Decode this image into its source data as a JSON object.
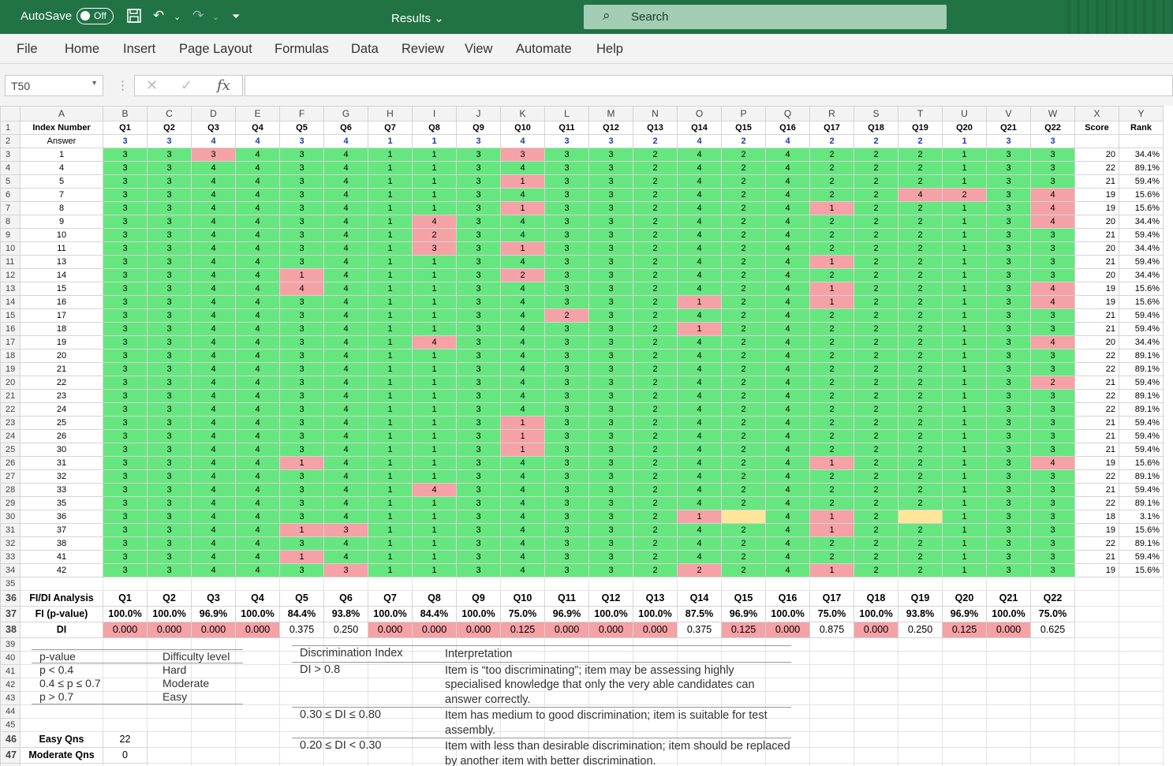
{
  "titlebar": {
    "autosave_label": "AutoSave",
    "autosave_state": "Off",
    "doc_title": "Results ⌄",
    "search_placeholder": "Search"
  },
  "menu": [
    "File",
    "Home",
    "Insert",
    "Page Layout",
    "Formulas",
    "Data",
    "Review",
    "View",
    "Automate",
    "Help"
  ],
  "formula_bar": {
    "name_box": "T50",
    "formula": ""
  },
  "columns": [
    "A",
    "B",
    "C",
    "D",
    "E",
    "F",
    "G",
    "H",
    "I",
    "J",
    "K",
    "L",
    "M",
    "N",
    "O",
    "P",
    "Q",
    "R",
    "S",
    "T",
    "U",
    "V",
    "W",
    "X",
    "Y"
  ],
  "header_row": [
    "Index Number",
    "Q1",
    "Q2",
    "Q3",
    "Q4",
    "Q5",
    "Q6",
    "Q7",
    "Q8",
    "Q9",
    "Q10",
    "Q11",
    "Q12",
    "Q13",
    "Q14",
    "Q15",
    "Q16",
    "Q17",
    "Q18",
    "Q19",
    "Q20",
    "Q21",
    "Q22",
    "Score",
    "Rank"
  ],
  "answer_row": {
    "label": "Answer",
    "values": [
      "3",
      "3",
      "4",
      "4",
      "3",
      "4",
      "1",
      "1",
      "3",
      "4",
      "3",
      "3",
      "2",
      "4",
      "2",
      "4",
      "2",
      "2",
      "2",
      "1",
      "3",
      "3"
    ]
  },
  "students": [
    {
      "id": "1",
      "ans": [
        "3",
        "3",
        "3",
        "4",
        "3",
        "4",
        "1",
        "1",
        "3",
        "3",
        "3",
        "3",
        "2",
        "4",
        "2",
        "4",
        "2",
        "2",
        "2",
        "1",
        "3",
        "3"
      ],
      "score": "20",
      "rank": "34.4%"
    },
    {
      "id": "4",
      "ans": [
        "3",
        "3",
        "4",
        "4",
        "3",
        "4",
        "1",
        "1",
        "3",
        "4",
        "3",
        "3",
        "2",
        "4",
        "2",
        "4",
        "2",
        "2",
        "2",
        "1",
        "3",
        "3"
      ],
      "score": "22",
      "rank": "89.1%"
    },
    {
      "id": "5",
      "ans": [
        "3",
        "3",
        "4",
        "4",
        "3",
        "4",
        "1",
        "1",
        "3",
        "1",
        "3",
        "3",
        "2",
        "4",
        "2",
        "4",
        "2",
        "2",
        "2",
        "1",
        "3",
        "3"
      ],
      "score": "21",
      "rank": "59.4%"
    },
    {
      "id": "7",
      "ans": [
        "3",
        "3",
        "4",
        "4",
        "3",
        "4",
        "1",
        "1",
        "3",
        "4",
        "3",
        "3",
        "2",
        "4",
        "2",
        "4",
        "2",
        "2",
        "4",
        "2",
        "3",
        "4"
      ],
      "score": "19",
      "rank": "15.6%"
    },
    {
      "id": "8",
      "ans": [
        "3",
        "3",
        "4",
        "4",
        "3",
        "4",
        "1",
        "1",
        "3",
        "1",
        "3",
        "3",
        "2",
        "4",
        "2",
        "4",
        "1",
        "2",
        "2",
        "1",
        "3",
        "4"
      ],
      "score": "19",
      "rank": "15.6%"
    },
    {
      "id": "9",
      "ans": [
        "3",
        "3",
        "4",
        "4",
        "3",
        "4",
        "1",
        "4",
        "3",
        "4",
        "3",
        "3",
        "2",
        "4",
        "2",
        "4",
        "2",
        "2",
        "2",
        "1",
        "3",
        "4"
      ],
      "score": "20",
      "rank": "34.4%"
    },
    {
      "id": "10",
      "ans": [
        "3",
        "3",
        "4",
        "4",
        "3",
        "4",
        "1",
        "2",
        "3",
        "4",
        "3",
        "3",
        "2",
        "4",
        "2",
        "4",
        "2",
        "2",
        "2",
        "1",
        "3",
        "3"
      ],
      "score": "21",
      "rank": "59.4%"
    },
    {
      "id": "11",
      "ans": [
        "3",
        "3",
        "4",
        "4",
        "3",
        "4",
        "1",
        "3",
        "3",
        "1",
        "3",
        "3",
        "2",
        "4",
        "2",
        "4",
        "2",
        "2",
        "2",
        "1",
        "3",
        "3"
      ],
      "score": "20",
      "rank": "34.4%"
    },
    {
      "id": "13",
      "ans": [
        "3",
        "3",
        "4",
        "4",
        "3",
        "4",
        "1",
        "1",
        "3",
        "4",
        "3",
        "3",
        "2",
        "4",
        "2",
        "4",
        "1",
        "2",
        "2",
        "1",
        "3",
        "3"
      ],
      "score": "21",
      "rank": "59.4%"
    },
    {
      "id": "14",
      "ans": [
        "3",
        "3",
        "4",
        "4",
        "1",
        "4",
        "1",
        "1",
        "3",
        "2",
        "3",
        "3",
        "2",
        "4",
        "2",
        "4",
        "2",
        "2",
        "2",
        "1",
        "3",
        "3"
      ],
      "score": "20",
      "rank": "34.4%"
    },
    {
      "id": "15",
      "ans": [
        "3",
        "3",
        "4",
        "4",
        "4",
        "4",
        "1",
        "1",
        "3",
        "4",
        "3",
        "3",
        "2",
        "4",
        "2",
        "4",
        "1",
        "2",
        "2",
        "1",
        "3",
        "4"
      ],
      "score": "19",
      "rank": "15.6%"
    },
    {
      "id": "16",
      "ans": [
        "3",
        "3",
        "4",
        "4",
        "3",
        "4",
        "1",
        "1",
        "3",
        "4",
        "3",
        "3",
        "2",
        "1",
        "2",
        "4",
        "1",
        "2",
        "2",
        "1",
        "3",
        "4"
      ],
      "score": "19",
      "rank": "15.6%"
    },
    {
      "id": "17",
      "ans": [
        "3",
        "3",
        "4",
        "4",
        "3",
        "4",
        "1",
        "1",
        "3",
        "4",
        "2",
        "3",
        "2",
        "4",
        "2",
        "4",
        "2",
        "2",
        "2",
        "1",
        "3",
        "3"
      ],
      "score": "21",
      "rank": "59.4%"
    },
    {
      "id": "18",
      "ans": [
        "3",
        "3",
        "4",
        "4",
        "3",
        "4",
        "1",
        "1",
        "3",
        "4",
        "3",
        "3",
        "2",
        "1",
        "2",
        "4",
        "2",
        "2",
        "2",
        "1",
        "3",
        "3"
      ],
      "score": "21",
      "rank": "59.4%"
    },
    {
      "id": "19",
      "ans": [
        "3",
        "3",
        "4",
        "4",
        "3",
        "4",
        "1",
        "4",
        "3",
        "4",
        "3",
        "3",
        "2",
        "4",
        "2",
        "4",
        "2",
        "2",
        "2",
        "1",
        "3",
        "4"
      ],
      "score": "20",
      "rank": "34.4%"
    },
    {
      "id": "20",
      "ans": [
        "3",
        "3",
        "4",
        "4",
        "3",
        "4",
        "1",
        "1",
        "3",
        "4",
        "3",
        "3",
        "2",
        "4",
        "2",
        "4",
        "2",
        "2",
        "2",
        "1",
        "3",
        "3"
      ],
      "score": "22",
      "rank": "89.1%"
    },
    {
      "id": "21",
      "ans": [
        "3",
        "3",
        "4",
        "4",
        "3",
        "4",
        "1",
        "1",
        "3",
        "4",
        "3",
        "3",
        "2",
        "4",
        "2",
        "4",
        "2",
        "2",
        "2",
        "1",
        "3",
        "3"
      ],
      "score": "22",
      "rank": "89.1%"
    },
    {
      "id": "22",
      "ans": [
        "3",
        "3",
        "4",
        "4",
        "3",
        "4",
        "1",
        "1",
        "3",
        "4",
        "3",
        "3",
        "2",
        "4",
        "2",
        "4",
        "2",
        "2",
        "2",
        "1",
        "3",
        "2"
      ],
      "score": "21",
      "rank": "59.4%"
    },
    {
      "id": "23",
      "ans": [
        "3",
        "3",
        "4",
        "4",
        "3",
        "4",
        "1",
        "1",
        "3",
        "4",
        "3",
        "3",
        "2",
        "4",
        "2",
        "4",
        "2",
        "2",
        "2",
        "1",
        "3",
        "3"
      ],
      "score": "22",
      "rank": "89.1%"
    },
    {
      "id": "24",
      "ans": [
        "3",
        "3",
        "4",
        "4",
        "3",
        "4",
        "1",
        "1",
        "3",
        "4",
        "3",
        "3",
        "2",
        "4",
        "2",
        "4",
        "2",
        "2",
        "2",
        "1",
        "3",
        "3"
      ],
      "score": "22",
      "rank": "89.1%"
    },
    {
      "id": "25",
      "ans": [
        "3",
        "3",
        "4",
        "4",
        "3",
        "4",
        "1",
        "1",
        "3",
        "1",
        "3",
        "3",
        "2",
        "4",
        "2",
        "4",
        "2",
        "2",
        "2",
        "1",
        "3",
        "3"
      ],
      "score": "21",
      "rank": "59.4%"
    },
    {
      "id": "26",
      "ans": [
        "3",
        "3",
        "4",
        "4",
        "3",
        "4",
        "1",
        "1",
        "3",
        "1",
        "3",
        "3",
        "2",
        "4",
        "2",
        "4",
        "2",
        "2",
        "2",
        "1",
        "3",
        "3"
      ],
      "score": "21",
      "rank": "59.4%"
    },
    {
      "id": "30",
      "ans": [
        "3",
        "3",
        "4",
        "4",
        "3",
        "4",
        "1",
        "1",
        "3",
        "1",
        "3",
        "3",
        "2",
        "4",
        "2",
        "4",
        "2",
        "2",
        "2",
        "1",
        "3",
        "3"
      ],
      "score": "21",
      "rank": "59.4%"
    },
    {
      "id": "31",
      "ans": [
        "3",
        "3",
        "4",
        "4",
        "1",
        "4",
        "1",
        "1",
        "3",
        "4",
        "3",
        "3",
        "2",
        "4",
        "2",
        "4",
        "1",
        "2",
        "2",
        "1",
        "3",
        "4"
      ],
      "score": "19",
      "rank": "15.6%"
    },
    {
      "id": "32",
      "ans": [
        "3",
        "3",
        "4",
        "4",
        "3",
        "4",
        "1",
        "1",
        "3",
        "4",
        "3",
        "3",
        "2",
        "4",
        "2",
        "4",
        "2",
        "2",
        "2",
        "1",
        "3",
        "3"
      ],
      "score": "22",
      "rank": "89.1%"
    },
    {
      "id": "33",
      "ans": [
        "3",
        "3",
        "4",
        "4",
        "3",
        "4",
        "1",
        "4",
        "3",
        "4",
        "3",
        "3",
        "2",
        "4",
        "2",
        "4",
        "2",
        "2",
        "2",
        "1",
        "3",
        "3"
      ],
      "score": "21",
      "rank": "59.4%"
    },
    {
      "id": "35",
      "ans": [
        "3",
        "3",
        "4",
        "4",
        "3",
        "4",
        "1",
        "1",
        "3",
        "4",
        "3",
        "3",
        "2",
        "4",
        "2",
        "4",
        "2",
        "2",
        "2",
        "1",
        "3",
        "3"
      ],
      "score": "22",
      "rank": "89.1%"
    },
    {
      "id": "36",
      "ans": [
        "3",
        "3",
        "4",
        "4",
        "3",
        "4",
        "1",
        "1",
        "3",
        "4",
        "3",
        "3",
        "2",
        "1",
        "",
        "4",
        "1",
        "2",
        "",
        "1",
        "3",
        "3"
      ],
      "score": "18",
      "rank": "3.1%"
    },
    {
      "id": "37",
      "ans": [
        "3",
        "3",
        "4",
        "4",
        "1",
        "3",
        "1",
        "1",
        "3",
        "4",
        "3",
        "3",
        "2",
        "4",
        "2",
        "4",
        "1",
        "2",
        "2",
        "1",
        "3",
        "3"
      ],
      "score": "19",
      "rank": "15.6%"
    },
    {
      "id": "38",
      "ans": [
        "3",
        "3",
        "4",
        "4",
        "3",
        "4",
        "1",
        "1",
        "3",
        "4",
        "3",
        "3",
        "2",
        "4",
        "2",
        "4",
        "2",
        "2",
        "2",
        "1",
        "3",
        "3"
      ],
      "score": "22",
      "rank": "89.1%"
    },
    {
      "id": "41",
      "ans": [
        "3",
        "3",
        "4",
        "4",
        "1",
        "4",
        "1",
        "1",
        "3",
        "4",
        "3",
        "3",
        "2",
        "4",
        "2",
        "4",
        "2",
        "2",
        "2",
        "1",
        "3",
        "3"
      ],
      "score": "21",
      "rank": "59.4%"
    },
    {
      "id": "42",
      "ans": [
        "3",
        "3",
        "4",
        "4",
        "3",
        "3",
        "1",
        "1",
        "3",
        "4",
        "3",
        "3",
        "2",
        "2",
        "2",
        "4",
        "1",
        "2",
        "2",
        "1",
        "3",
        "3"
      ],
      "score": "19",
      "rank": "15.6%"
    }
  ],
  "analysis": {
    "header_label": "FI/DI Analysis",
    "fi_label": "FI (p-value)",
    "di_label": "DI",
    "questions": [
      "Q1",
      "Q2",
      "Q3",
      "Q4",
      "Q5",
      "Q6",
      "Q7",
      "Q8",
      "Q9",
      "Q10",
      "Q11",
      "Q12",
      "Q13",
      "Q14",
      "Q15",
      "Q16",
      "Q17",
      "Q18",
      "Q19",
      "Q20",
      "Q21",
      "Q22"
    ],
    "fi": [
      "100.0%",
      "100.0%",
      "96.9%",
      "100.0%",
      "84.4%",
      "93.8%",
      "100.0%",
      "84.4%",
      "100.0%",
      "75.0%",
      "96.9%",
      "100.0%",
      "100.0%",
      "87.5%",
      "96.9%",
      "100.0%",
      "75.0%",
      "100.0%",
      "93.8%",
      "96.9%",
      "100.0%",
      "75.0%"
    ],
    "di": [
      "0.000",
      "0.000",
      "0.000",
      "0.000",
      "0.375",
      "0.250",
      "0.000",
      "0.000",
      "0.000",
      "0.125",
      "0.000",
      "0.000",
      "0.000",
      "0.375",
      "0.125",
      "0.000",
      "0.875",
      "0.000",
      "0.250",
      "0.125",
      "0.000",
      "0.625"
    ]
  },
  "summary": [
    {
      "label": "Easy Qns",
      "value": "22"
    },
    {
      "label": "Moderate Qns",
      "value": "0"
    }
  ],
  "difficulty_legend": {
    "headers": [
      "p-value",
      "Difficulty level"
    ],
    "rows": [
      [
        "p < 0.4",
        "Hard"
      ],
      [
        "0.4 ≤  p ≤  0.7",
        "Moderate"
      ],
      [
        "p > 0.7",
        "Easy"
      ]
    ]
  },
  "discrimination_legend": {
    "headers": [
      "Discrimination Index",
      "Interpretation"
    ],
    "rows": [
      [
        "DI > 0.8",
        "Item is “too discriminating”; item may be assessing highly specialised knowledge that only the very able candidates can answer correctly."
      ],
      [
        "0.30 ≤ DI ≤ 0.80",
        "Item has medium to good discrimination; item is suitable for test assembly."
      ],
      [
        "0.20 ≤ DI < 0.30",
        "Item with less than desirable discrimination; item should be replaced by another item with better discrimination."
      ]
    ]
  },
  "colors": {
    "correct": "#66e67f",
    "wrong": "#f4a2a5",
    "blank": "#ffe699",
    "excel_green": "#217346"
  }
}
